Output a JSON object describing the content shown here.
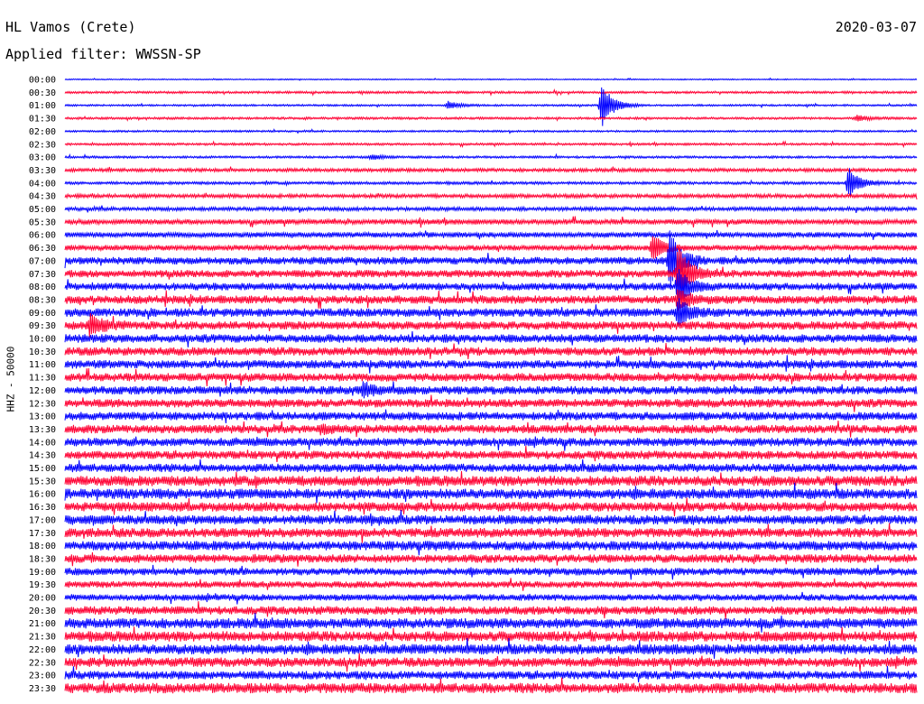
{
  "header": {
    "station": "HL Vamos (Crete)",
    "date": "2020-03-07",
    "filter": "Applied filter: WWSSN-SP"
  },
  "chart_data": {
    "type": "line",
    "title": "HL Vamos (Crete)",
    "subtitle": "Applied filter: WWSSN-SP",
    "date": "2020-03-07",
    "ylabel": "HHZ - 50000",
    "xlabel": "",
    "y_tick_labels": [
      "00:00",
      "00:30",
      "01:00",
      "01:30",
      "02:00",
      "02:30",
      "03:00",
      "03:30",
      "04:00",
      "04:30",
      "05:00",
      "05:30",
      "06:00",
      "06:30",
      "07:00",
      "07:30",
      "08:00",
      "08:30",
      "09:00",
      "09:30",
      "10:00",
      "10:30",
      "11:00",
      "11:30",
      "12:00",
      "12:30",
      "13:00",
      "13:30",
      "14:00",
      "14:30",
      "15:00",
      "15:30",
      "16:00",
      "16:30",
      "17:00",
      "17:30",
      "18:00",
      "18:30",
      "19:00",
      "19:30",
      "20:00",
      "20:30",
      "21:00",
      "21:30",
      "22:00",
      "22:30",
      "23:00",
      "23:30"
    ],
    "trace_colors": [
      "#0000ff",
      "#ff0033"
    ],
    "noise_amplitude": [
      0.06,
      0.12,
      0.1,
      0.12,
      0.1,
      0.12,
      0.12,
      0.18,
      0.15,
      0.2,
      0.2,
      0.28,
      0.28,
      0.3,
      0.4,
      0.4,
      0.4,
      0.45,
      0.45,
      0.45,
      0.45,
      0.45,
      0.45,
      0.45,
      0.45,
      0.45,
      0.45,
      0.45,
      0.45,
      0.45,
      0.45,
      0.55,
      0.55,
      0.5,
      0.5,
      0.5,
      0.5,
      0.45,
      0.4,
      0.35,
      0.35,
      0.45,
      0.55,
      0.55,
      0.55,
      0.5,
      0.45,
      0.55
    ],
    "events": [
      {
        "row": 2,
        "time_fraction": 0.63,
        "amplitude": 3.5
      },
      {
        "row": 2,
        "time_fraction": 0.45,
        "amplitude": 0.6
      },
      {
        "row": 3,
        "time_fraction": 0.93,
        "amplitude": 0.5
      },
      {
        "row": 6,
        "time_fraction": 0.36,
        "amplitude": 0.4
      },
      {
        "row": 8,
        "time_fraction": 0.92,
        "amplitude": 2.5
      },
      {
        "row": 13,
        "time_fraction": 0.69,
        "amplitude": 2.0
      },
      {
        "row": 14,
        "time_fraction": 0.71,
        "amplitude": 4.5
      },
      {
        "row": 15,
        "time_fraction": 0.72,
        "amplitude": 4.5
      },
      {
        "row": 16,
        "time_fraction": 0.72,
        "amplitude": 3.0
      },
      {
        "row": 17,
        "time_fraction": 0.72,
        "amplitude": 1.5
      },
      {
        "row": 18,
        "time_fraction": 0.72,
        "amplitude": 2.0
      },
      {
        "row": 19,
        "time_fraction": 0.03,
        "amplitude": 1.5
      },
      {
        "row": 24,
        "time_fraction": 0.35,
        "amplitude": 1.0
      },
      {
        "row": 27,
        "time_fraction": 0.3,
        "amplitude": 0.5
      }
    ],
    "grid": false,
    "legend": "none"
  }
}
